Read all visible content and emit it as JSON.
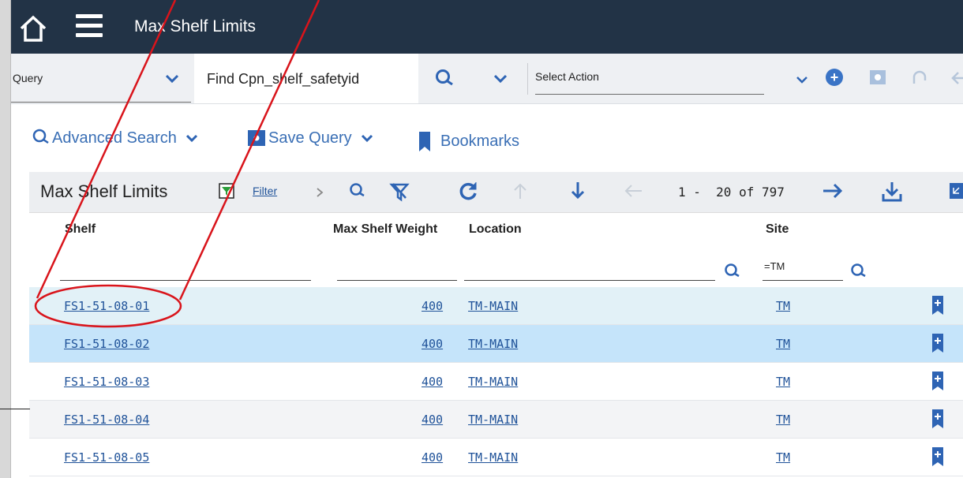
{
  "app": {
    "title": "Max Shelf Limits"
  },
  "querybar": {
    "query_label": "Query",
    "find_value": "Find Cpn_shelf_safetyid",
    "action_label": "Select Action"
  },
  "tools": {
    "advanced_search": "Advanced Search",
    "save_query": "Save Query",
    "bookmarks": "Bookmarks"
  },
  "grid": {
    "title": "Max Shelf Limits",
    "filter_label": "Filter",
    "pagination": "1 -  20 of 797",
    "columns": [
      "Shelf",
      "Max Shelf Weight",
      "Location",
      "Site"
    ],
    "site_filter": "=TM",
    "rows": [
      {
        "shelf": "FS1-51-08-01",
        "weight": "400",
        "location": "TM-MAIN",
        "site": "TM"
      },
      {
        "shelf": "FS1-51-08-02",
        "weight": "400",
        "location": "TM-MAIN",
        "site": "TM"
      },
      {
        "shelf": "FS1-51-08-03",
        "weight": "400",
        "location": "TM-MAIN",
        "site": "TM"
      },
      {
        "shelf": "FS1-51-08-04",
        "weight": "400",
        "location": "TM-MAIN",
        "site": "TM"
      },
      {
        "shelf": "FS1-51-08-05",
        "weight": "400",
        "location": "TM-MAIN",
        "site": "TM"
      }
    ]
  },
  "colors": {
    "topbar": "#223346",
    "accent": "#3a6fb5",
    "row_hover": "#e2f1f7",
    "row_selected": "#c5e4fa",
    "annotation": "#d9141b"
  }
}
